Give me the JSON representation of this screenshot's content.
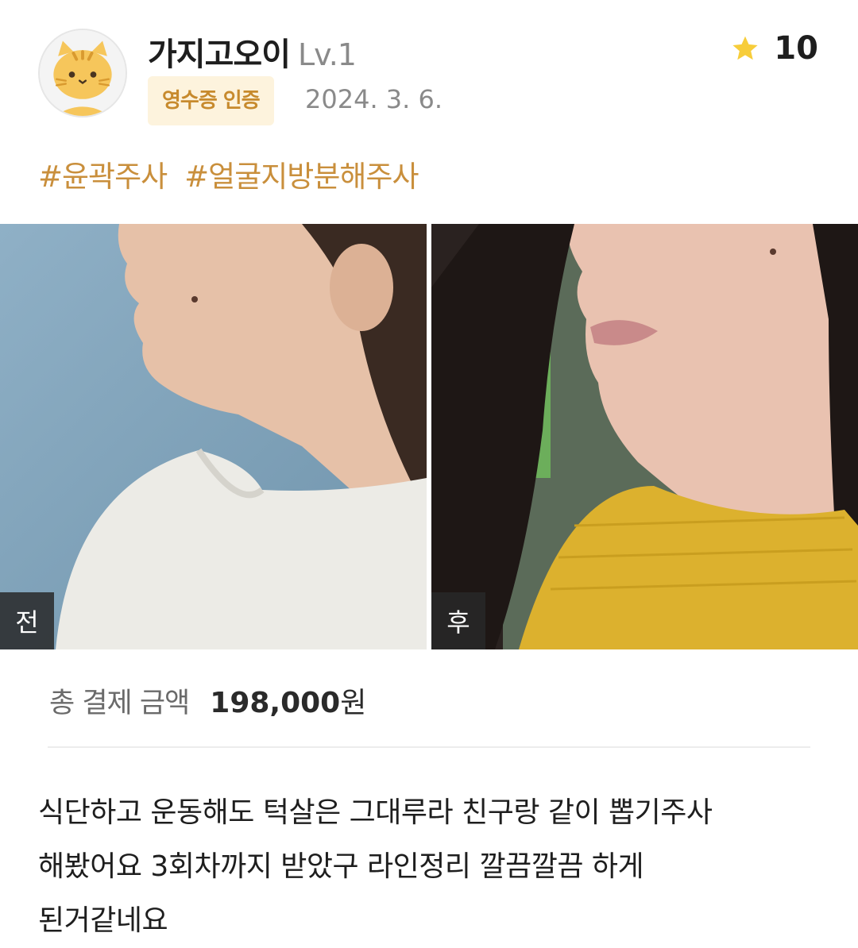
{
  "author": {
    "name": "가지고오이",
    "level": "Lv.1",
    "avatar_icon": "cat-avatar-icon"
  },
  "badge": "영수증 인증",
  "date": "2024. 3. 6.",
  "rating": {
    "icon": "star-icon",
    "value": "10",
    "star_color": "#f7cd3a"
  },
  "tags": [
    "#윤곽주사",
    "#얼굴지방분해주사"
  ],
  "photos": [
    {
      "label": "전"
    },
    {
      "label": "후"
    }
  ],
  "payment": {
    "label": "총 결제 금액",
    "amount": "198,000",
    "unit": "원"
  },
  "review_lines": [
    "식단하고 운동해도 턱살은 그대루라 친구랑 같이 뽑기주사",
    "해봤어요 3회차까지 받았구 라인정리 깔끔깔끔 하게",
    "된거같네요"
  ],
  "colors": {
    "accent": "#c98f3c",
    "badge_bg": "#fdf3dd",
    "badge_text": "#c78a2d"
  }
}
